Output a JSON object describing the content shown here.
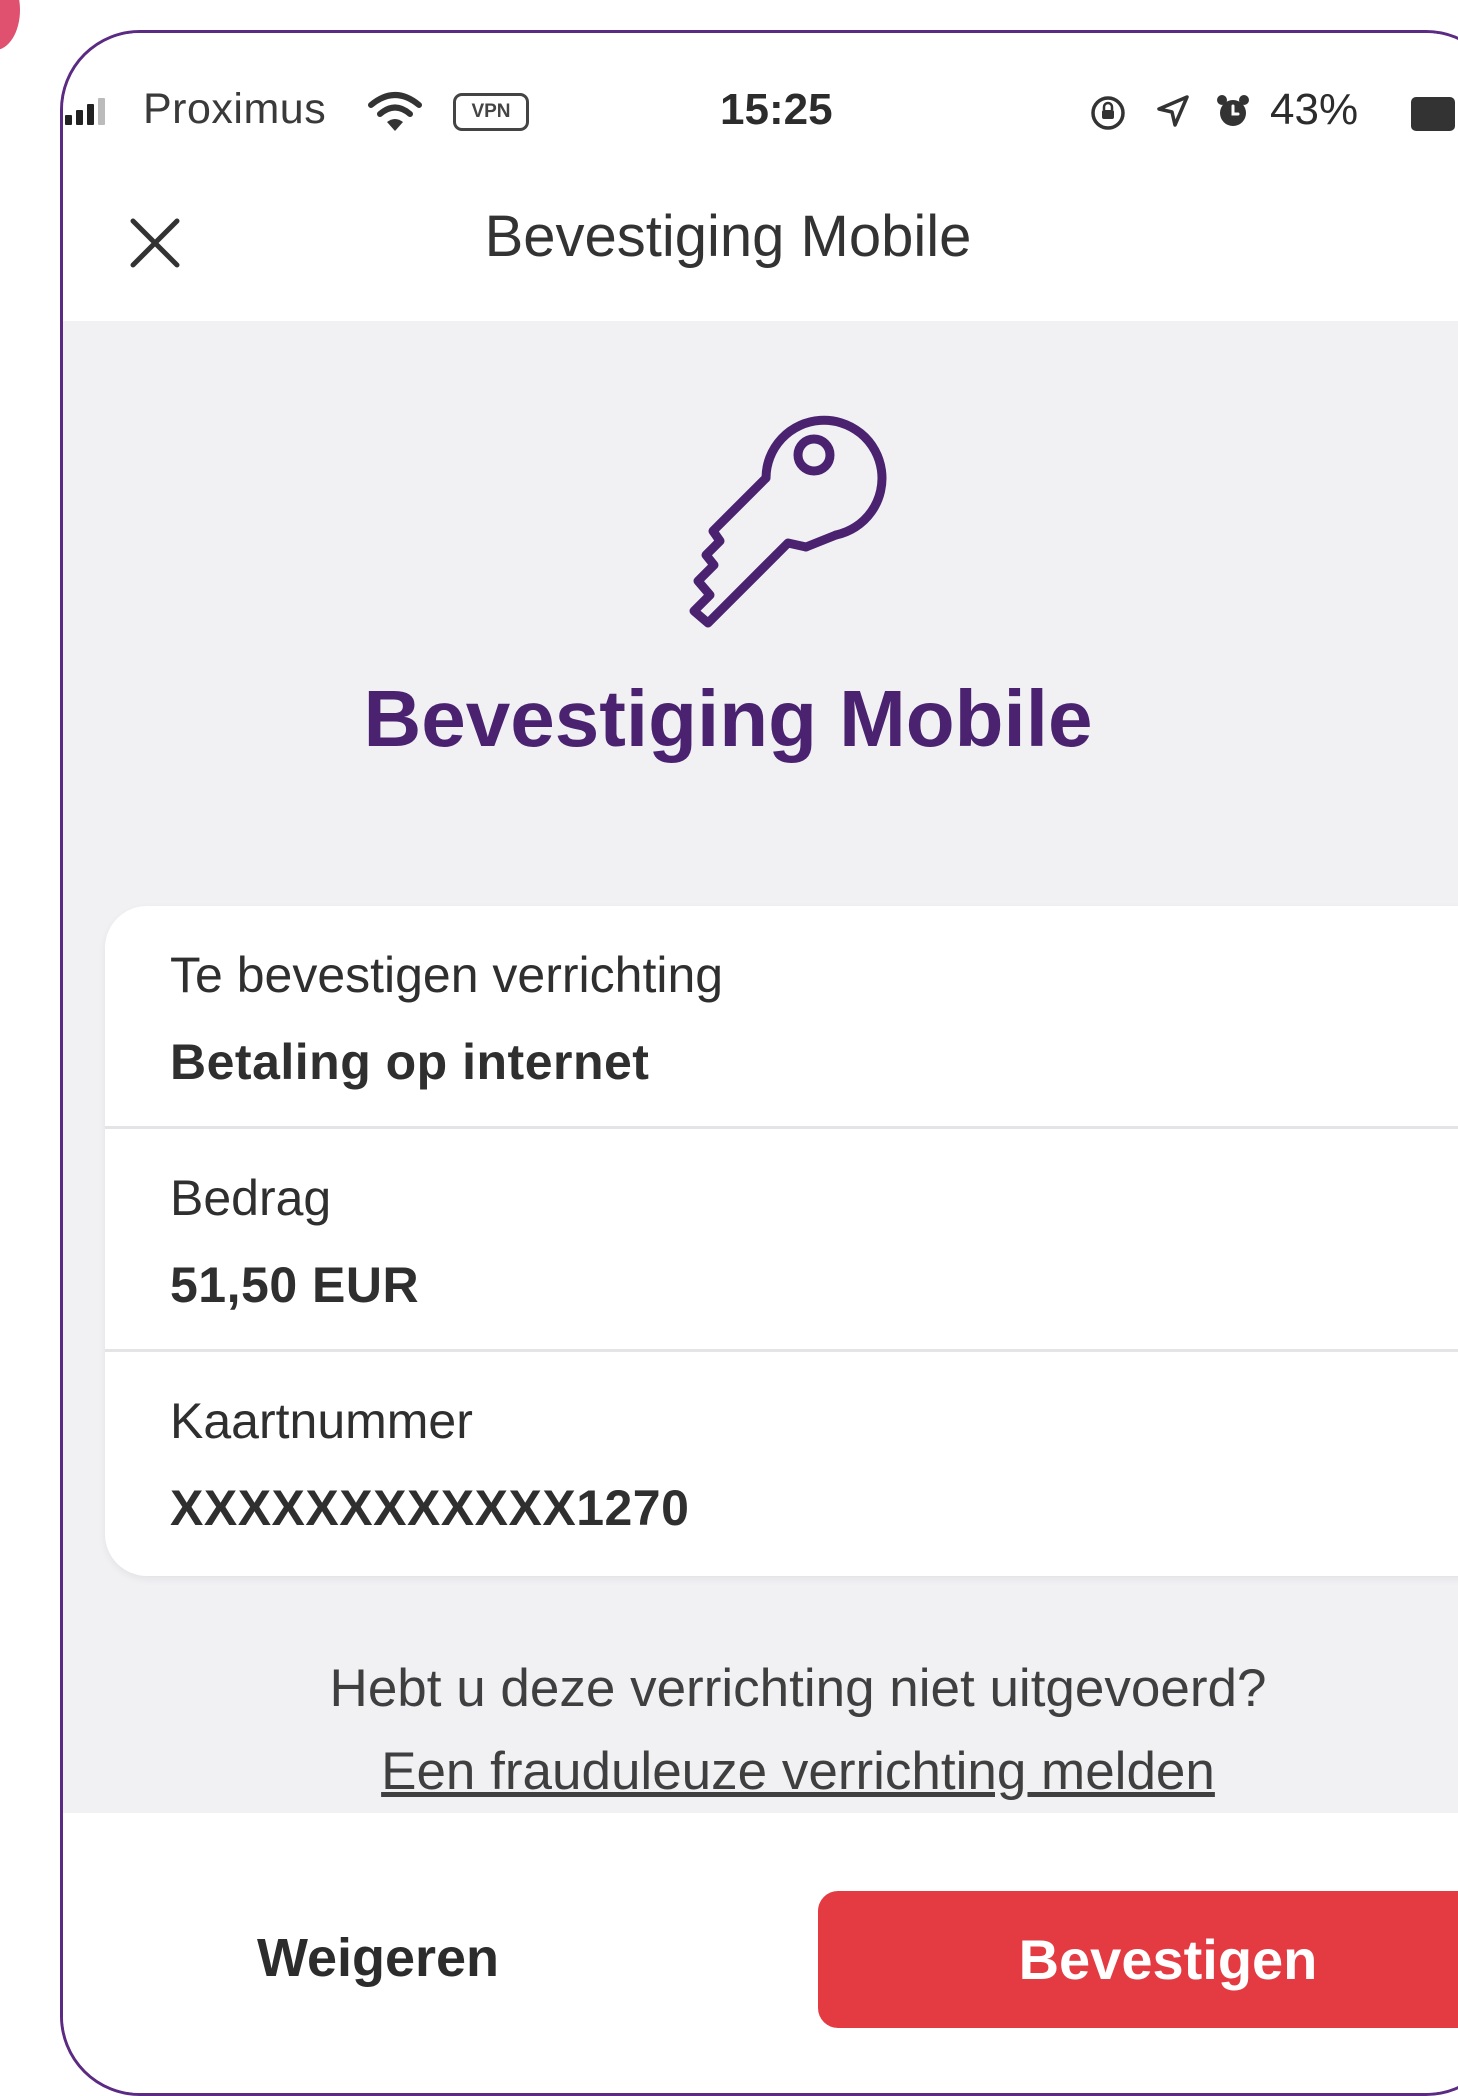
{
  "status_bar": {
    "carrier": "Proximus",
    "vpn": "VPN",
    "time": "15:25",
    "battery": "43%"
  },
  "nav": {
    "title": "Bevestiging Mobile"
  },
  "hero": {
    "title": "Bevestiging Mobile"
  },
  "details": [
    {
      "label": "Te bevestigen verrichting",
      "value": "Betaling op internet"
    },
    {
      "label": "Bedrag",
      "value": "51,50 EUR"
    },
    {
      "label": "Kaartnummer",
      "value": "XXXXXXXXXXXX1270"
    }
  ],
  "fraud": {
    "question": "Hebt u deze verrichting niet uitgevoerd?",
    "link": "Een frauduleuze verrichting melden"
  },
  "actions": {
    "reject": "Weigeren",
    "confirm": "Bevestigen"
  },
  "colors": {
    "accent_purple": "#4a2270",
    "confirm_red": "#e43b43",
    "background": "#f1f1f4"
  },
  "icons": {
    "close": "close-icon",
    "key": "key-icon",
    "wifi": "wifi-icon",
    "signal": "signal-icon",
    "location": "location-icon",
    "alarm": "alarm-icon",
    "battery": "battery-icon"
  }
}
